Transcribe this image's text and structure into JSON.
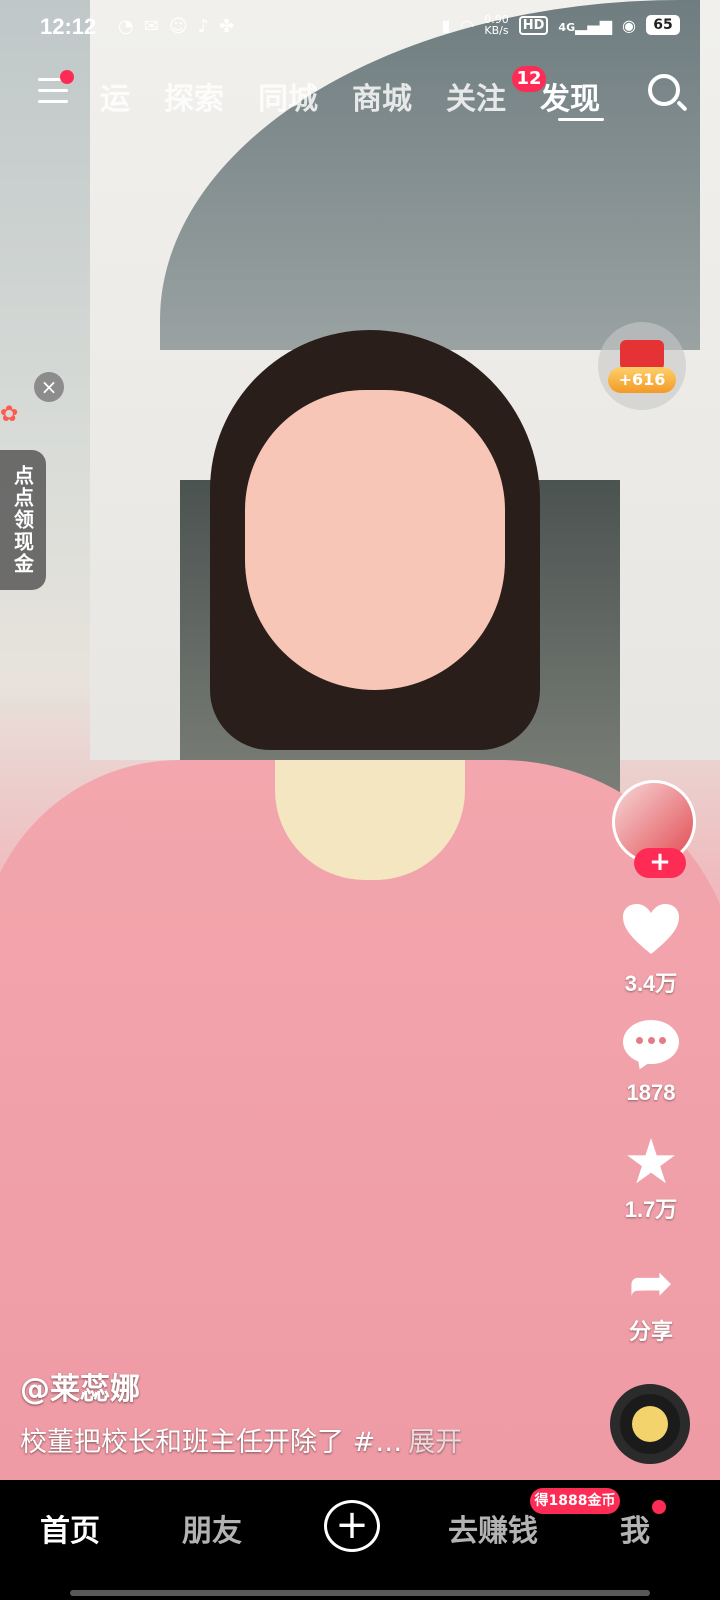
{
  "status_bar": {
    "time": "12:12",
    "network_speed": "0.90\nKB/s",
    "hd": "HD",
    "signal": "4G",
    "battery": "65"
  },
  "top_nav": {
    "tabs": [
      "运",
      "探索",
      "同城",
      "商城",
      "关注",
      "发现"
    ],
    "active_tab": "发现",
    "follow_badge": "12"
  },
  "red_packet": {
    "coins": "+616"
  },
  "side_promo": {
    "label": "点点领现金"
  },
  "right_rail": {
    "likes": "3.4万",
    "comments": "1878",
    "favorites": "1.7万",
    "share": "分享"
  },
  "video_info": {
    "author": "@莱蕊娜",
    "caption": "校董把校长和班主任开除了 #…",
    "expand": "展开"
  },
  "bottom_nav": {
    "home": "首页",
    "friends": "朋友",
    "earn": "去赚钱",
    "earn_badge": "得1888金币",
    "me": "我"
  },
  "colors": {
    "accent": "#fe2c55"
  }
}
